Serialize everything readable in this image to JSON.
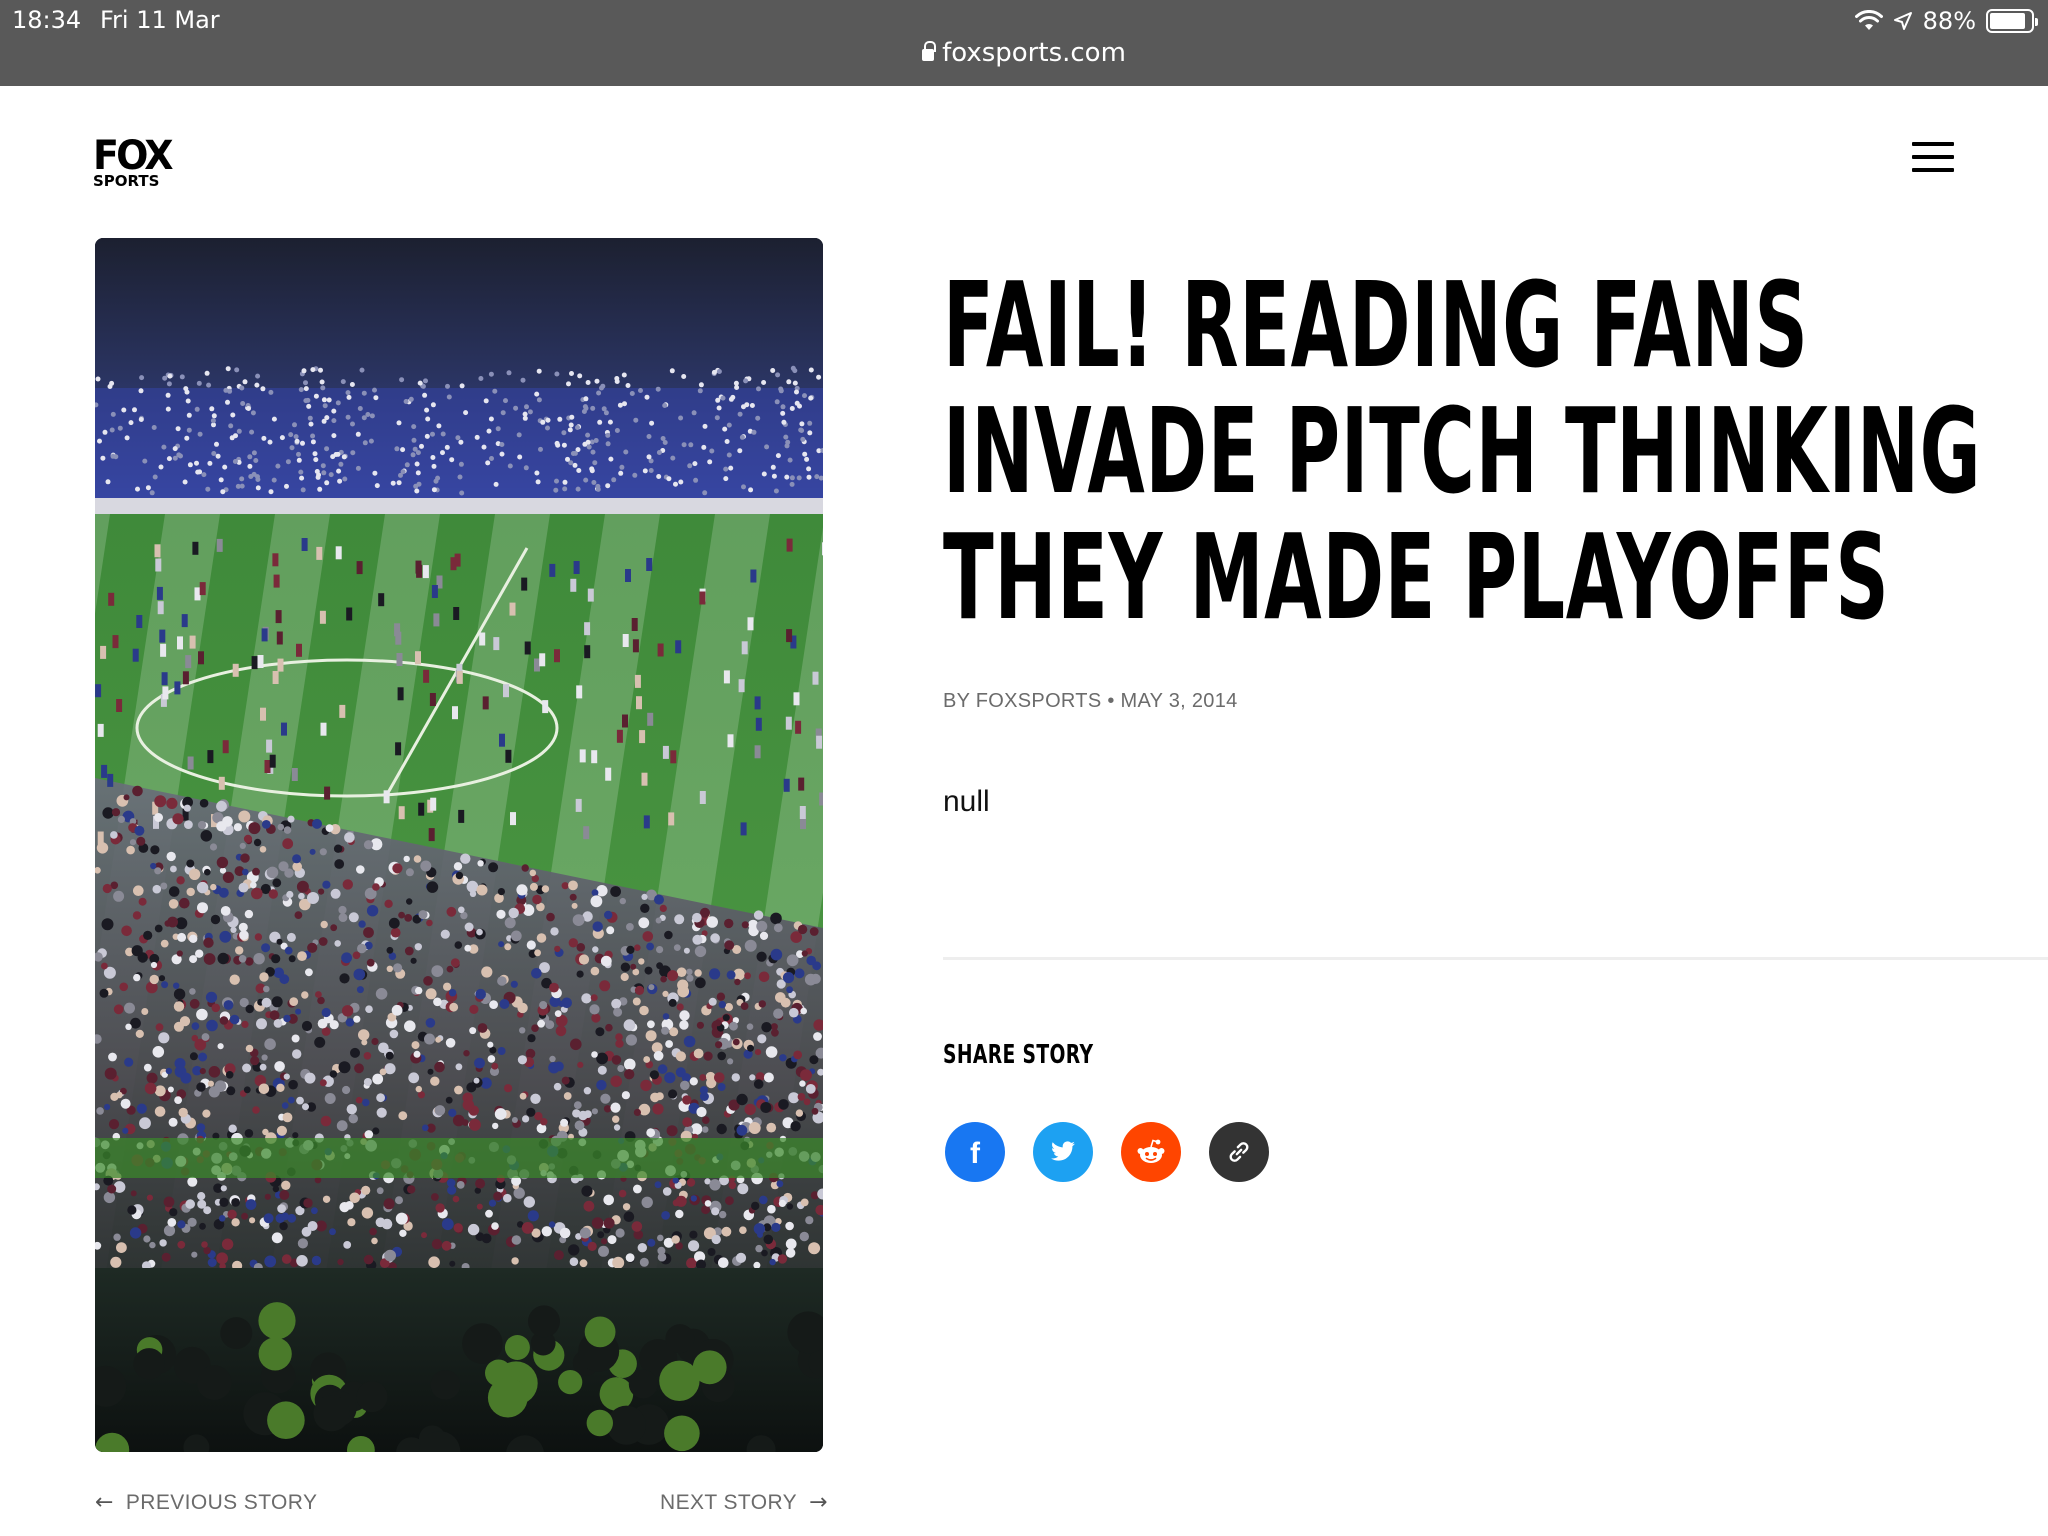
{
  "status_bar": {
    "time": "18:34",
    "date": "Fri 11 Mar",
    "battery": "88%",
    "battery_level": 0.88
  },
  "url_bar": {
    "url": "foxsports.com"
  },
  "header": {
    "logo_line1": "FOX",
    "logo_line2": "SPORTS"
  },
  "article": {
    "headline": "FAIL! READING FANS INVADE PITCH THINKING THEY MADE PLAYOFFS",
    "byline": "BY FOXSPORTS • MAY 3, 2014",
    "body": "null"
  },
  "share": {
    "title": "SHARE STORY",
    "buttons": [
      {
        "icon": "facebook-icon",
        "color": "#1877f2"
      },
      {
        "icon": "twitter-icon",
        "color": "#1da1f2"
      },
      {
        "icon": "reddit-icon",
        "color": "#ff4500"
      },
      {
        "icon": "link-icon",
        "color": "#333333"
      }
    ]
  },
  "nav": {
    "previous": "PREVIOUS STORY",
    "next": "NEXT STORY"
  }
}
